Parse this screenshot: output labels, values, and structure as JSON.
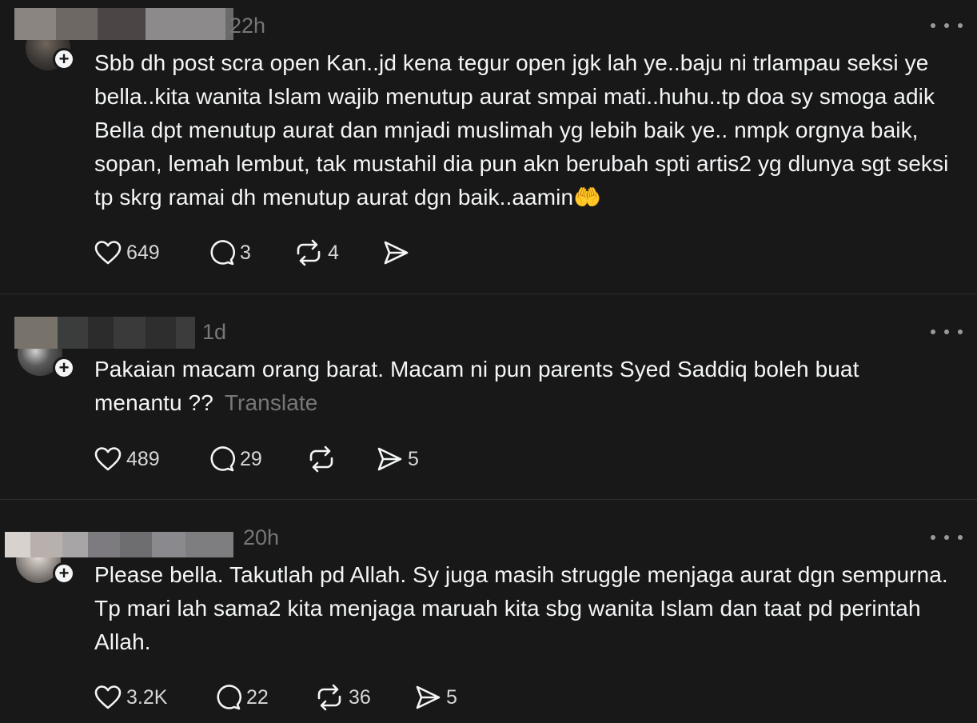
{
  "posts": [
    {
      "time": "22h",
      "text": "Sbb dh post scra open Kan..jd kena tegur open jgk lah ye..baju ni trlampau seksi ye bella..kita wanita Islam wajib menutup aurat smpai mati..huhu..tp doa sy smoga adik Bella dpt menutup aurat dan mnjadi muslimah yg lebih baik ye.. nmpk orgnya baik, sopan, lemah lembut, tak mustahil dia pun akn berubah spti artis2 yg dlunya sgt seksi tp skrg ramai dh menutup aurat dgn baik..aamin🤲",
      "likes": "649",
      "replies": "3",
      "reposts": "4",
      "shares": ""
    },
    {
      "time": "1d",
      "text": "Pakaian macam orang barat. Macam ni pun parents Syed Saddiq boleh buat menantu ??",
      "translate": "Translate",
      "likes": "489",
      "replies": "29",
      "reposts": "",
      "shares": "5"
    },
    {
      "time": "20h",
      "text": "Please bella. Takutlah pd Allah. Sy juga masih struggle menjaga aurat dgn sempurna. Tp mari lah sama2 kita menjaga maruah kita sbg wanita Islam dan taat pd perintah Allah.",
      "likes": "3.2K",
      "replies": "22",
      "reposts": "36",
      "shares": "5"
    }
  ],
  "colors": {
    "background": "#181818",
    "text": "#f3f5f7",
    "muted": "#777777",
    "divider": "#2f2f2f"
  },
  "icons": [
    "heart-icon",
    "reply-icon",
    "repost-icon",
    "share-icon",
    "more-icon",
    "follow-plus-icon"
  ]
}
